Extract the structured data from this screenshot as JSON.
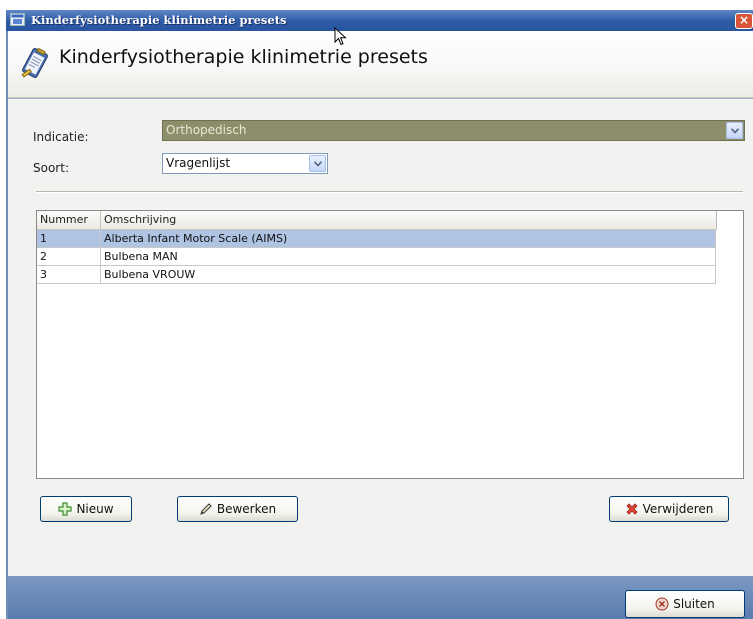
{
  "window": {
    "title": "Kinderfysiotherapie klinimetrie presets",
    "close_label": "×"
  },
  "header": {
    "title": "Kinderfysiotherapie klinimetrie presets"
  },
  "form": {
    "indicatie_label": "Indicatie:",
    "indicatie_value": "Orthopedisch",
    "soort_label": "Soort:",
    "soort_value": "Vragenlijst"
  },
  "table": {
    "columns": [
      "Nummer",
      "Omschrijving"
    ],
    "rows": [
      {
        "nummer": "1",
        "omschrijving": "Alberta Infant Motor Scale (AIMS)",
        "selected": true
      },
      {
        "nummer": "2",
        "omschrijving": "Bulbena MAN",
        "selected": false
      },
      {
        "nummer": "3",
        "omschrijving": "Bulbena VROUW",
        "selected": false
      }
    ]
  },
  "buttons": {
    "nieuw": "Nieuw",
    "bewerken": "Bewerken",
    "verwijderen": "Verwijderen",
    "sluiten": "Sluiten"
  },
  "icons": {
    "app": "app-window-icon",
    "header": "clipboard-pen-icon",
    "nieuw": "plus-icon",
    "bewerken": "pencil-icon",
    "verwijderen": "red-x-icon",
    "sluiten": "close-circle-icon"
  },
  "colors": {
    "titlebar": "#2d5aa6",
    "selected_row": "#aec4e2",
    "disabled_combo": "#8d8f6a",
    "footer": "#5a7cae"
  }
}
